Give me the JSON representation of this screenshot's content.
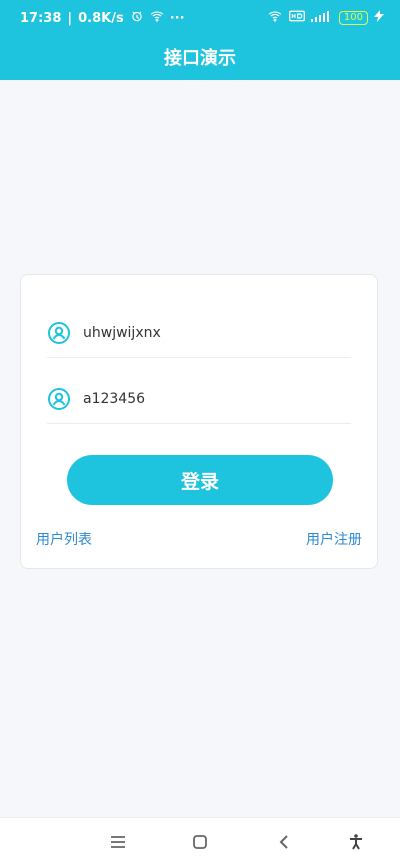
{
  "status_bar": {
    "time": "17:38",
    "speed": "0.8K/s",
    "dots": "···",
    "battery": "100"
  },
  "header": {
    "title": "接口演示"
  },
  "login": {
    "username_value": "uhwjwijxnx",
    "password_value": "a123456",
    "login_button_label": "登录",
    "user_list_label": "用户列表",
    "user_register_label": "用户注册"
  },
  "colors": {
    "accent": "#1ec3dd",
    "link": "#2e8ad2"
  },
  "icons": {
    "field_icon": "user-icon"
  }
}
